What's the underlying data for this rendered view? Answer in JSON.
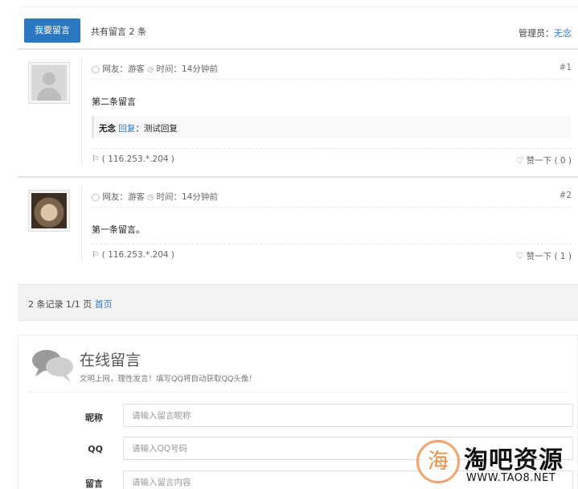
{
  "header": {
    "leave_button": "我要留言",
    "total_text": "共有留言 2 条",
    "admin_label": "管理员：",
    "admin_name": "无念"
  },
  "messages": [
    {
      "user": "网友：游客",
      "time": "时间：14分钟前",
      "floor": "#1",
      "content": "第二条留言",
      "reply": {
        "name": "无念",
        "reply_word": "回复",
        "text": "：测试回复"
      },
      "ip": "( 116.253.*.204 )",
      "like": "赞一下 ( 0 )",
      "avatar": "default-avatar"
    },
    {
      "user": "网友：游客",
      "time": "时间：14分钟前",
      "floor": "#2",
      "content": "第一条留言。",
      "ip": "( 116.253.*.204 )",
      "like": "赞一下 ( 1 )",
      "avatar": "cat-avatar"
    }
  ],
  "pager": {
    "summary": "2 条记录 1/1 页 ",
    "home": "首页"
  },
  "form": {
    "title": "在线留言",
    "subtitle": "文明上网，理性发言！填写QQ将自动获取QQ头像！",
    "fields": [
      {
        "label": "昵称",
        "placeholder": "请输入留言昵称"
      },
      {
        "label": "QQ",
        "placeholder": "请输入QQ号码"
      },
      {
        "label": "留言",
        "placeholder": "请输入留言内容"
      }
    ]
  },
  "watermark": {
    "glyph": "海",
    "name": "淘吧资源",
    "url": "WWW.TAO8.NET"
  },
  "colors": {
    "accent": "#2a78c2",
    "watermark_orange": "#f08a3c"
  }
}
